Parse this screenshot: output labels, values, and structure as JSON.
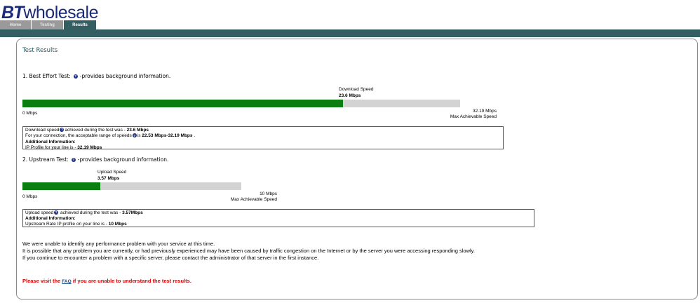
{
  "logo": {
    "bt": "BT",
    "wholesale": "wholesale"
  },
  "tabs": [
    {
      "label": "Home",
      "active": false
    },
    {
      "label": "Testing",
      "active": false
    },
    {
      "label": "Results",
      "active": true
    }
  ],
  "title": "Test Results",
  "download": {
    "heading": "1. Best Effort Test:",
    "help_text": "-provides background information.",
    "speed_label": "Download Speed",
    "speed_value": "23.6 Mbps",
    "min_label": "0 Mbps",
    "max_value": "32.19 Mbps",
    "max_label": "Max Achievable Speed",
    "fill_fraction": 0.733,
    "info": {
      "line1_pre": "Download speed",
      "line1_mid": "achieved during the test was - ",
      "line1_val": "23.6 Mbps",
      "line2_pre": "For your connection, the acceptable range of speeds",
      "line2_mid": "is ",
      "line2_val": "22.53 Mbps-32.19 Mbps",
      "line2_end": " .",
      "line3": "Additional Information:",
      "line4_pre": "IP Profile for your line is - ",
      "line4_val": "32.19 Mbps"
    }
  },
  "upload": {
    "heading": "2. Upstream Test:",
    "help_text": "-provides background information.",
    "speed_label": "Upload Speed",
    "speed_value": "3.57 Mbps",
    "min_label": "0 Mbps",
    "max_value": "10 Mbps",
    "max_label": "Max Achievable Speed",
    "fill_fraction": 0.357,
    "info": {
      "line1_pre": "Upload speed",
      "line1_mid": " achieved during the test was - ",
      "line1_val": "3.57Mbps",
      "line2": "Additional Information:",
      "line3_pre": "Upstream Rate IP profile on your line is - ",
      "line3_val": "10 Mbps"
    }
  },
  "message": {
    "line1": "We were unable to identify any performance problem with your service at this time.",
    "line2": "It is possible that any problem you are currently, or had previously experienced may have been caused by traffic congestion on the Internet or by the server you were accessing responding slowly.",
    "line3": "If you continue to encounter a problem with a specific server, please contact the administrator of that server in the first instance."
  },
  "warning": {
    "pre": "Please visit the ",
    "link": "FAQ",
    "post": " if you are unable to understand the test results."
  },
  "colors": {
    "accent": "#335f63",
    "bar_fill": "#0a7e10",
    "bar_track": "#d3d3d3",
    "logo": "#1b2a78",
    "warning": "#dd0000"
  }
}
